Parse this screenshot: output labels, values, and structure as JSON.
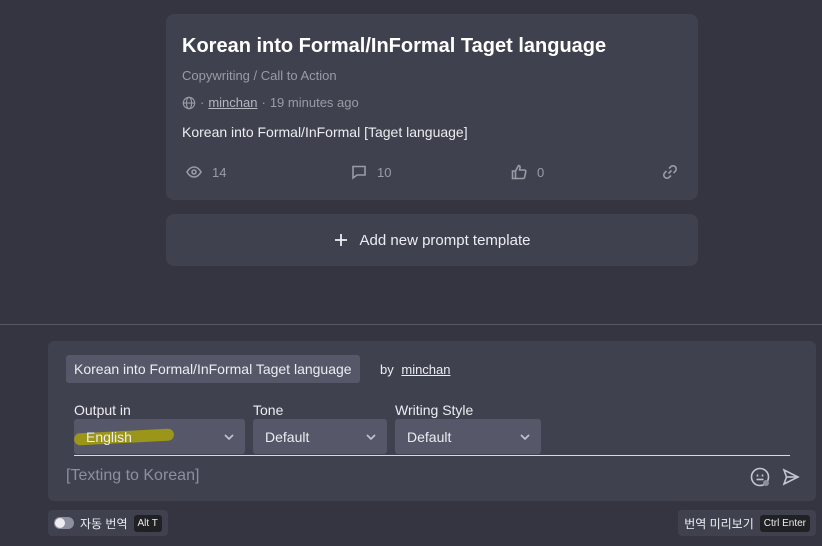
{
  "card": {
    "title": "Korean into Formal/InFormal Taget language",
    "category": "Copywriting / Call to Action",
    "separator": "·",
    "author": "minchan",
    "time": "19 minutes ago",
    "description": "Korean into Formal/InFormal [Taget language]",
    "views": "14",
    "comments": "10",
    "likes": "0"
  },
  "add_template_label": "Add new prompt template",
  "panel": {
    "template_name": "Korean into Formal/InFormal Taget language",
    "by_label": "by",
    "author": "minchan",
    "output_label": "Output in",
    "output_value": "English",
    "tone_label": "Tone",
    "tone_value": "Default",
    "style_label": "Writing Style",
    "style_value": "Default",
    "input_placeholder": "[Texting to Korean]"
  },
  "footer": {
    "auto_translate_label": "자동 번역",
    "auto_translate_shortcut": "Alt T",
    "preview_label": "번역 미리보기",
    "preview_shortcut": "Ctrl Enter"
  },
  "colors": {
    "background": "#343541",
    "card": "#40414f",
    "control": "#565869",
    "highlight": "#b3a900"
  }
}
